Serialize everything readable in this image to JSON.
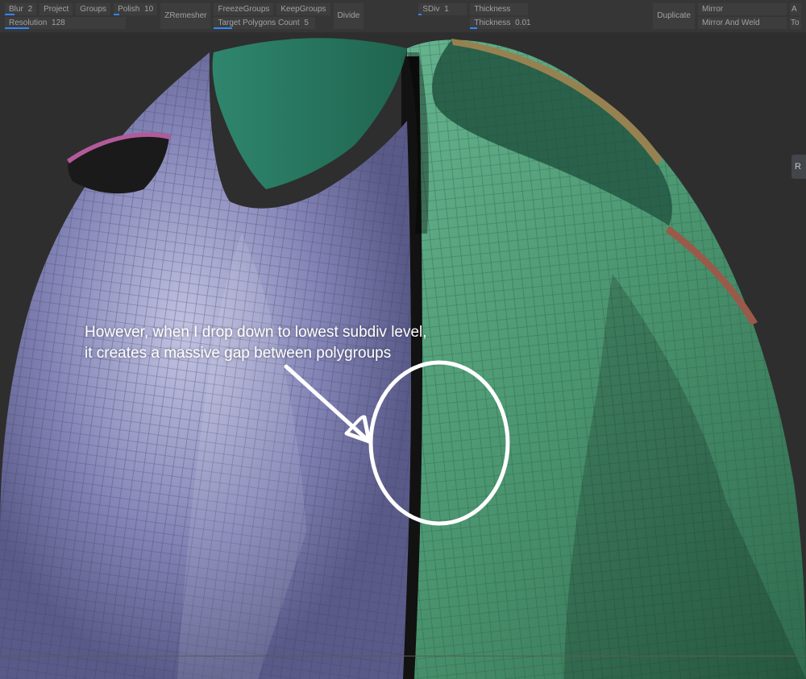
{
  "toolbar": {
    "row1": {
      "blur": {
        "label": "Blur",
        "value": "2",
        "fill": "30%"
      },
      "project": {
        "label": "Project"
      },
      "groups": {
        "label": "Groups"
      },
      "polish": {
        "label": "Polish",
        "value": "10",
        "fill": "12%"
      }
    },
    "row2": {
      "resolution": {
        "label": "Resolution",
        "value": "128",
        "fill": "20%"
      }
    },
    "zremesher": {
      "label": "ZRemesher"
    },
    "freeze": {
      "label": "FreezeGroups"
    },
    "keep": {
      "label": "KeepGroups"
    },
    "target": {
      "label": "Target Polygons Count",
      "value": "5",
      "fill": "18%"
    },
    "divide": {
      "label": "Divide"
    },
    "sdiv": {
      "label": "SDiv",
      "value": "1",
      "fill": "6%"
    },
    "thickLabel": {
      "label": "Thickness"
    },
    "thickness": {
      "label": "Thickness",
      "value": "0.01",
      "fill": "12%"
    },
    "duplicate": {
      "label": "Duplicate"
    },
    "mirror": {
      "label": "Mirror"
    },
    "mirrorWeld": {
      "label": "Mirror And Weld"
    },
    "a": {
      "label": "A"
    },
    "to": {
      "label": "To"
    }
  },
  "rightBtn": {
    "label": "R"
  },
  "annotation": {
    "line1": "However, when I drop down to lowest subdiv level,",
    "line2": "it creates a massive gap between polygroups"
  },
  "colors": {
    "purple": "#7a7bb0",
    "green": "#4f9b74",
    "teal": "#2e8a6e",
    "darkgap": "#151515",
    "pink": "#b25a9a",
    "olive": "#968250",
    "rust": "#9a5a4a",
    "white": "#ffffff"
  }
}
